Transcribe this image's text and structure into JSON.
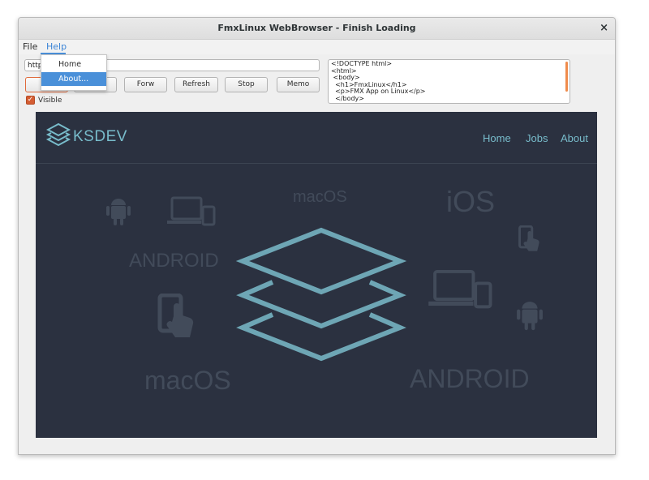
{
  "window": {
    "title": "FmxLinux WebBrowser - Finish Loading",
    "close_glyph": "×"
  },
  "menubar": {
    "items": [
      "File",
      "Help"
    ]
  },
  "help_menu": {
    "items": [
      "Home",
      "About..."
    ],
    "selected": "About..."
  },
  "toolbar": {
    "address_value": "http",
    "buttons": [
      "",
      "",
      "Forw",
      "Refresh",
      "Stop",
      "Memo"
    ],
    "visible_label": "Visible",
    "visible_checked": true
  },
  "memo": {
    "text": "<!DOCTYPE html>\n<html>\n <body>\n  <h1>FmxLinux</h1>\n  <p>FMX App on Linux</p>\n  </body>"
  },
  "site": {
    "brand": "KSDEV",
    "nav": [
      "Home",
      "Jobs",
      "About"
    ],
    "background_words": [
      "macOS",
      "iOS",
      "ANDROID",
      "macOS",
      "ANDROID"
    ],
    "icons": [
      "android-icon",
      "devices-icon",
      "tap-phone-icon",
      "layers-logo-icon"
    ],
    "colors": {
      "background": "#2b3140",
      "accent": "#78bccb",
      "faint_text": "#424b5a"
    }
  }
}
